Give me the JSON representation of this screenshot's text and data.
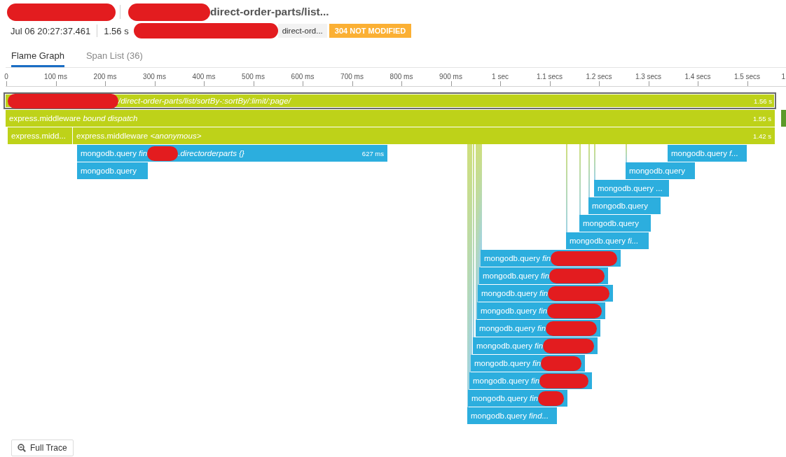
{
  "header": {
    "title_parts": [
      {
        "kind": "redaction"
      },
      {
        "kind": "separator"
      },
      {
        "kind": "redaction"
      },
      {
        "kind": "title",
        "text": "direct-order-parts/list..."
      }
    ],
    "meta_parts": [
      {
        "kind": "timestamp",
        "text": "Jul 06 20:27:37.461"
      },
      {
        "kind": "separator"
      },
      {
        "kind": "duration",
        "text": "1.56 s"
      },
      {
        "kind": "redaction"
      },
      {
        "kind": "tag",
        "text": "direct-ord..."
      },
      {
        "kind": "badge",
        "text": "304 NOT MODIFIED"
      }
    ]
  },
  "tabs": [
    {
      "label": "Flame Graph",
      "selected": true
    },
    {
      "label": "Span List (36)",
      "selected": false
    }
  ],
  "timeline": {
    "ticks": [
      "0",
      "100 ms",
      "200 ms",
      "300 ms",
      "400 ms",
      "500 ms",
      "600 ms",
      "700 ms",
      "800 ms",
      "900 ms",
      "1 sec",
      "1.1 secs",
      "1.2 secs",
      "1.3 secs",
      "1.4 secs",
      "1.5 secs",
      "1"
    ]
  },
  "spans": [
    {
      "parts": [
        {
          "kind": "redaction"
        },
        {
          "kind": "resource",
          "text": "/direct-order-parts/list/sortBy-:sortBy/:limit/:page/"
        }
      ],
      "duration": "1.56 s",
      "color": "#bed219",
      "selected": true
    },
    {
      "parts": [
        {
          "kind": "name",
          "text": "express.middleware"
        },
        {
          "kind": "resource",
          "text": "bound dispatch"
        }
      ],
      "duration": "1.55 s",
      "color": "#bed219",
      "selected": false
    },
    {
      "color": "#5b9a2a",
      "selected": false
    },
    {
      "parts": [
        {
          "kind": "name",
          "text": "express.midd..."
        }
      ],
      "color": "#bed219",
      "selected": false
    },
    {
      "parts": [
        {
          "kind": "name",
          "text": "express.middleware"
        },
        {
          "kind": "resource",
          "text": "<anonymous>"
        }
      ],
      "duration": "1.42 s",
      "color": "#bed219",
      "selected": false
    },
    {
      "parts": [
        {
          "kind": "name",
          "text": "mongodb.query"
        },
        {
          "kind": "resource",
          "text": "fin"
        },
        {
          "kind": "redaction"
        },
        {
          "kind": "resource",
          "text": ".directorderparts {}"
        }
      ],
      "duration": "627 ms",
      "color": "#2caede",
      "selected": false
    },
    {
      "parts": [
        {
          "kind": "name",
          "text": "mongodb.query"
        },
        {
          "kind": "resource",
          "text": "f..."
        }
      ],
      "color": "#2caede",
      "selected": false
    },
    {
      "parts": [
        {
          "kind": "name",
          "text": "mongodb.query"
        }
      ],
      "color": "#2caede",
      "selected": false
    },
    {
      "parts": [
        {
          "kind": "name",
          "text": "mongodb.query"
        }
      ],
      "color": "#2caede",
      "selected": false
    },
    {
      "parts": [
        {
          "kind": "name",
          "text": "mongodb.query ..."
        }
      ],
      "color": "#2caede",
      "selected": false
    },
    {
      "parts": [
        {
          "kind": "name",
          "text": "mongodb.query"
        }
      ],
      "color": "#2caede",
      "selected": false
    },
    {
      "parts": [
        {
          "kind": "name",
          "text": "mongodb.query"
        }
      ],
      "color": "#2caede",
      "selected": false
    },
    {
      "parts": [
        {
          "kind": "name",
          "text": "mongodb.query"
        },
        {
          "kind": "resource",
          "text": "fi..."
        }
      ],
      "color": "#2caede",
      "selected": false
    },
    {
      "parts": [
        {
          "kind": "name",
          "text": "mongodb.query"
        },
        {
          "kind": "resource",
          "text": "fin"
        },
        {
          "kind": "redaction"
        }
      ],
      "color": "#2caede",
      "selected": false
    },
    {
      "parts": [
        {
          "kind": "name",
          "text": "mongodb.query"
        },
        {
          "kind": "resource",
          "text": "fin"
        },
        {
          "kind": "redaction"
        }
      ],
      "color": "#2caede",
      "selected": false
    },
    {
      "parts": [
        {
          "kind": "name",
          "text": "mongodb.query"
        },
        {
          "kind": "resource",
          "text": "fin"
        },
        {
          "kind": "redaction"
        }
      ],
      "color": "#2caede",
      "selected": false
    },
    {
      "parts": [
        {
          "kind": "name",
          "text": "mongodb.query"
        },
        {
          "kind": "resource",
          "text": "fin"
        },
        {
          "kind": "redaction"
        }
      ],
      "color": "#2caede",
      "selected": false
    },
    {
      "parts": [
        {
          "kind": "name",
          "text": "mongodb.query"
        },
        {
          "kind": "resource",
          "text": "fin"
        },
        {
          "kind": "redaction"
        }
      ],
      "color": "#2caede",
      "selected": false
    },
    {
      "parts": [
        {
          "kind": "name",
          "text": "mongodb.query"
        },
        {
          "kind": "resource",
          "text": "fin"
        },
        {
          "kind": "redaction"
        }
      ],
      "color": "#2caede",
      "selected": false
    },
    {
      "parts": [
        {
          "kind": "name",
          "text": "mongodb.query"
        },
        {
          "kind": "resource",
          "text": "fin"
        },
        {
          "kind": "redaction"
        }
      ],
      "color": "#2caede",
      "selected": false
    },
    {
      "parts": [
        {
          "kind": "name",
          "text": "mongodb.query"
        },
        {
          "kind": "resource",
          "text": "fin"
        },
        {
          "kind": "redaction"
        }
      ],
      "color": "#2caede",
      "selected": false
    },
    {
      "parts": [
        {
          "kind": "name",
          "text": "mongodb.query"
        },
        {
          "kind": "resource",
          "text": "fin"
        },
        {
          "kind": "redaction"
        }
      ],
      "color": "#2caede",
      "selected": false
    },
    {
      "parts": [
        {
          "kind": "name",
          "text": "mongodb.query"
        },
        {
          "kind": "resource",
          "text": "find..."
        }
      ],
      "color": "#2caede",
      "selected": false
    }
  ],
  "footer": {
    "button": "Full Trace"
  }
}
